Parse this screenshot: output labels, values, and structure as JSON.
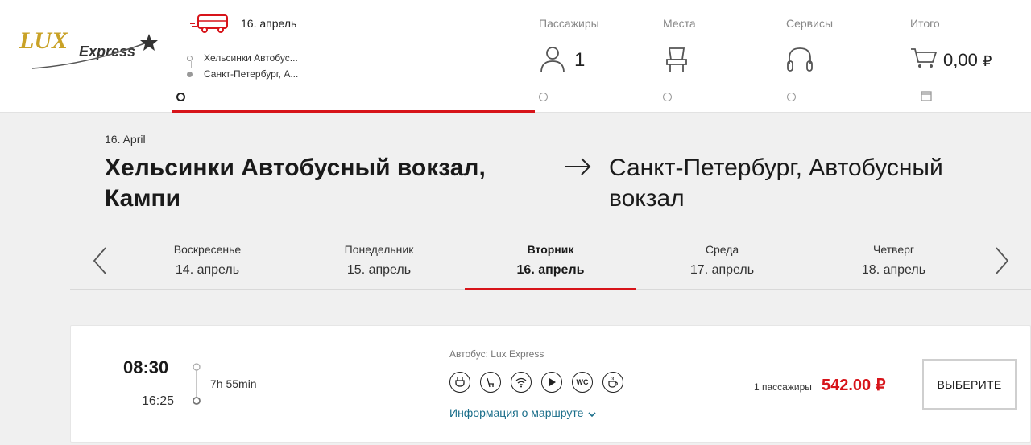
{
  "brand": {
    "logo_text_main": "LUX",
    "logo_text_sub": "Express",
    "accent_color": "#d7141a",
    "link_color": "#1a6e8a"
  },
  "header": {
    "trip_date": "16. апрель",
    "route_from_short": "Хельсинки Автобус...",
    "route_to_short": "Санкт-Петербург, А...",
    "steps": {
      "passengers_label": "Пассажиры",
      "passengers_count": "1",
      "seats_label": "Места",
      "services_label": "Сервисы",
      "total_label": "Итого",
      "total_amount": "0,00",
      "total_currency": "₽"
    },
    "icons": [
      "bus-icon",
      "person-icon",
      "seat-icon",
      "headphones-icon",
      "cart-icon",
      "calendar-icon"
    ]
  },
  "route": {
    "date": "16. April",
    "from": "Хельсинки Автобусный вокзал, Кампи",
    "to": "Санкт-Петербург, Автобусный вокзал"
  },
  "date_tabs": [
    {
      "day": "Воскресенье",
      "date": "14. апрель",
      "active": false
    },
    {
      "day": "Понедельник",
      "date": "15. апрель",
      "active": false
    },
    {
      "day": "Вторник",
      "date": "16. апрель",
      "active": true
    },
    {
      "day": "Среда",
      "date": "17. апрель",
      "active": false
    },
    {
      "day": "Четверг",
      "date": "18. апрель",
      "active": false
    }
  ],
  "trip": {
    "departure": "08:30",
    "arrival": "16:25",
    "duration": "7h 55min",
    "operator": "Автобус: Lux Express",
    "amenities": [
      "power-outlet-icon",
      "seat-recline-icon",
      "wifi-icon",
      "play-icon",
      "wc-icon",
      "coffee-icon"
    ],
    "amenity_wc_text": "WC",
    "route_info": "Информация о маршруте",
    "passengers": "1 пассажиры",
    "price": "542.00 ₽",
    "select_button": "ВЫБЕРИТЕ"
  }
}
